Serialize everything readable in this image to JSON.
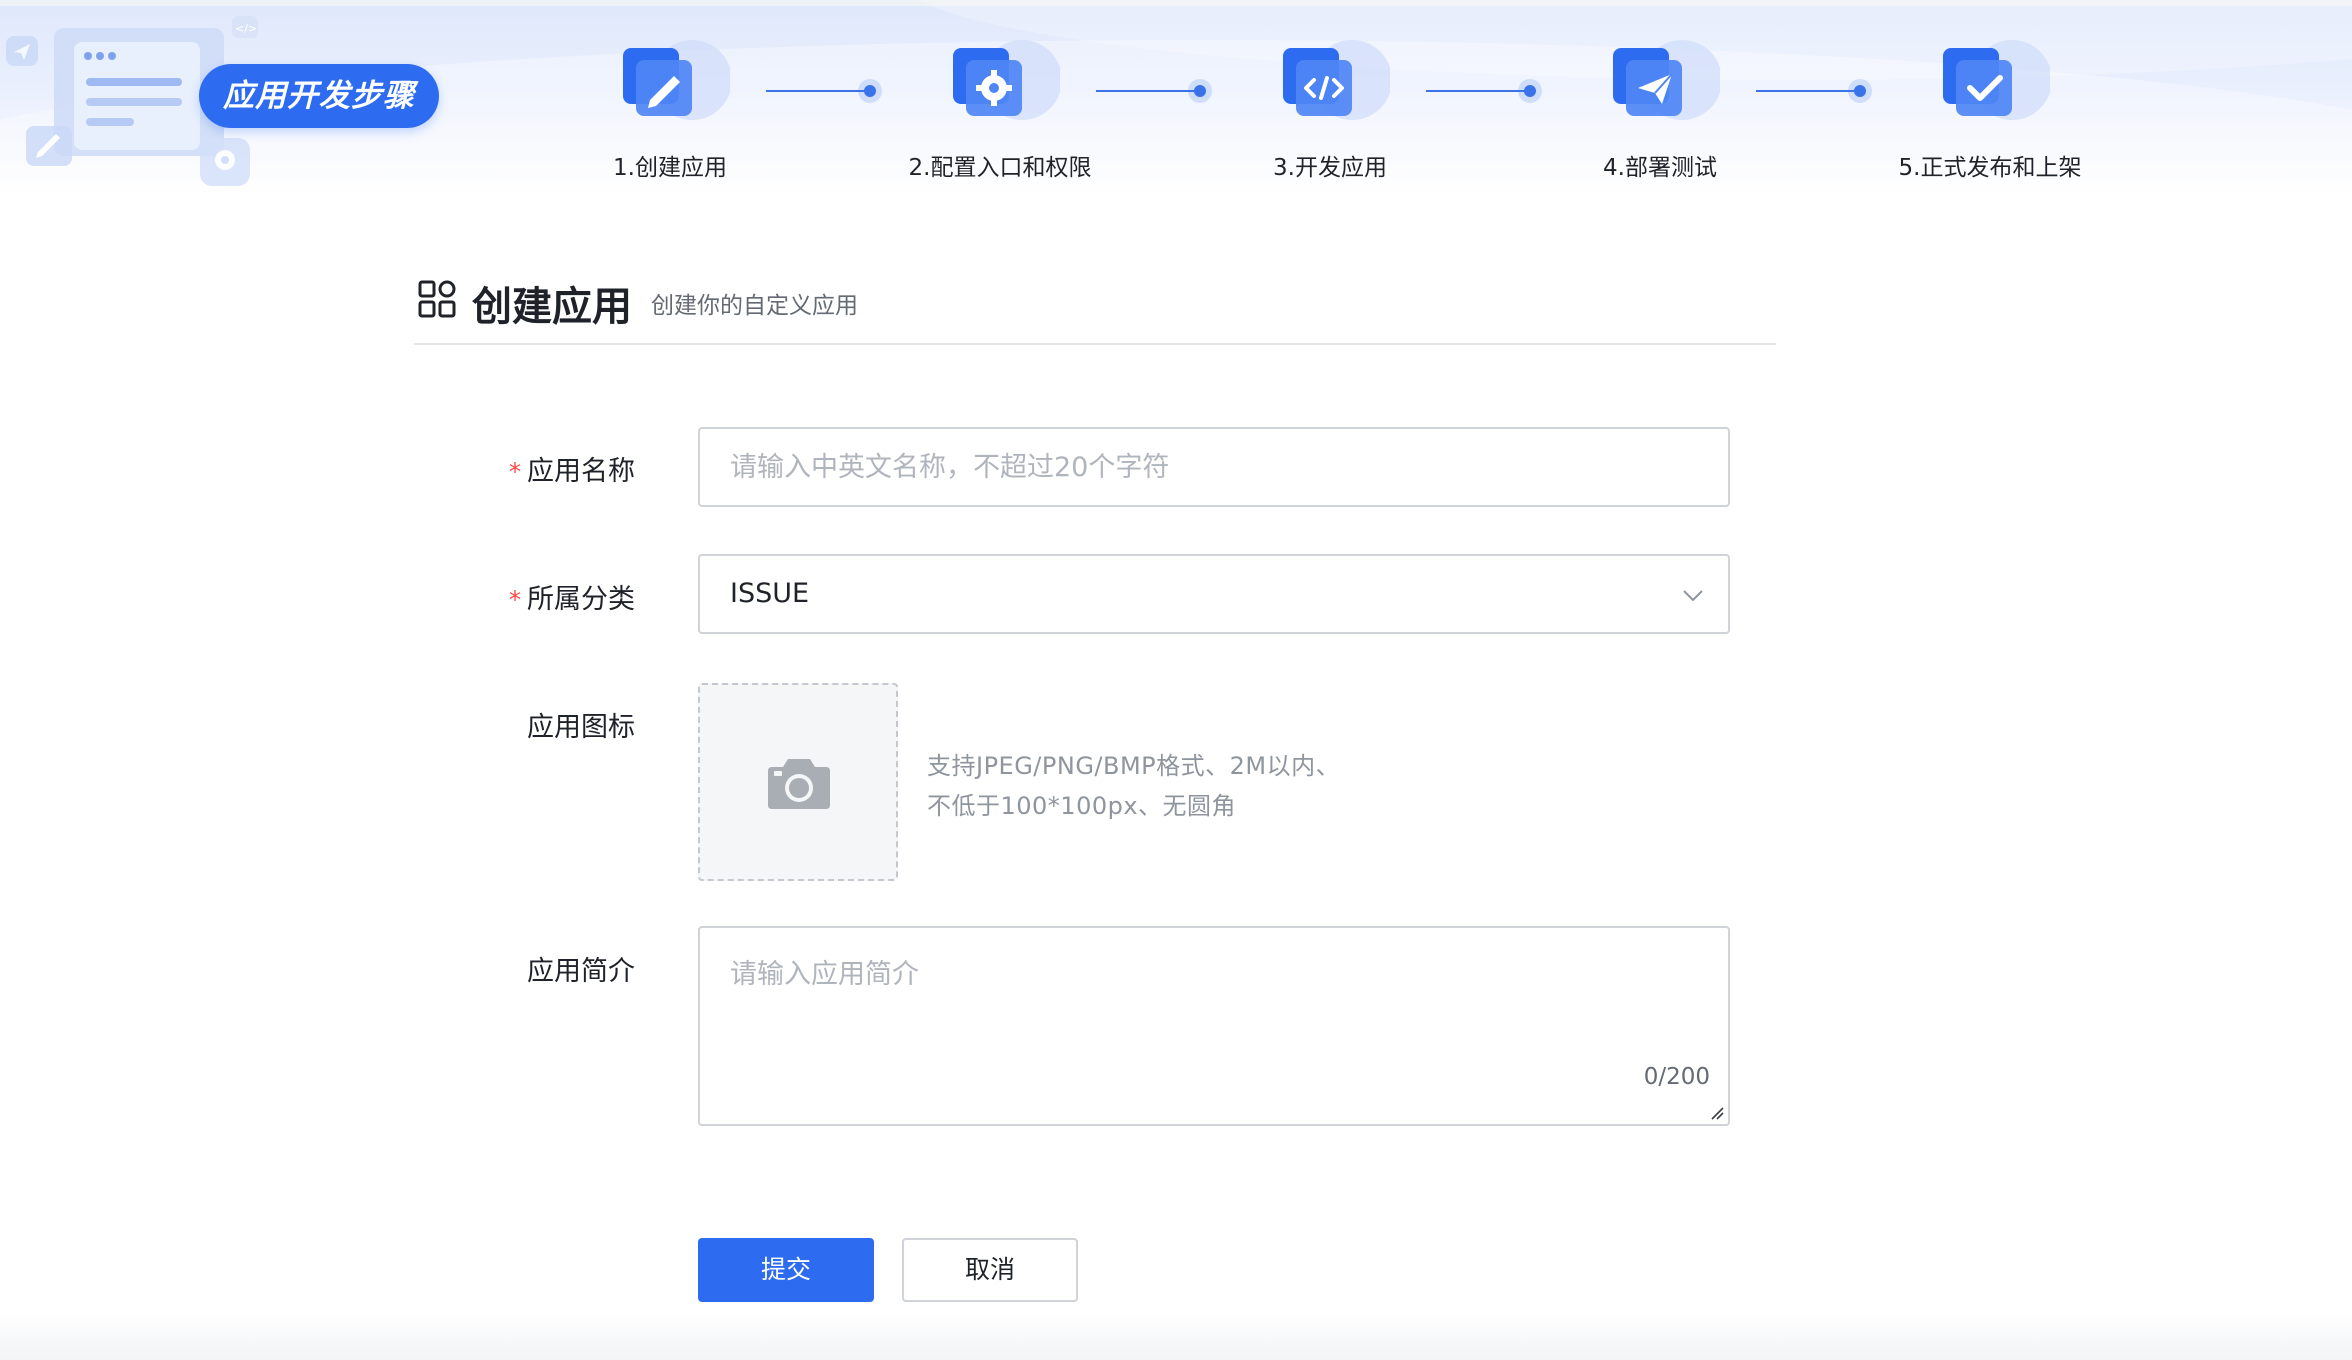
{
  "header": {
    "badge": "应用开发步骤",
    "steps": [
      {
        "label": "1.创建应用",
        "icon": "edit-pen-icon"
      },
      {
        "label": "2.配置入口和权限",
        "icon": "settings-gear-icon"
      },
      {
        "label": "3.开发应用",
        "icon": "code-icon"
      },
      {
        "label": "4.部署测试",
        "icon": "paper-plane-icon"
      },
      {
        "label": "5.正式发布和上架",
        "icon": "checkmark-icon"
      }
    ]
  },
  "section": {
    "title": "创建应用",
    "subtitle": "创建你的自定义应用"
  },
  "form": {
    "name": {
      "label": "应用名称",
      "placeholder": "请输入中英文名称，不超过20个字符",
      "value": "",
      "required": true
    },
    "category": {
      "label": "所属分类",
      "value": "ISSUE",
      "required": true
    },
    "icon": {
      "label": "应用图标",
      "hint_line1": "支持JPEG/PNG/BMP格式、2M以内、",
      "hint_line2": "不低于100*100px、无圆角"
    },
    "intro": {
      "label": "应用简介",
      "placeholder": "请输入应用简介",
      "counter": "0/200"
    }
  },
  "actions": {
    "submit": "提交",
    "cancel": "取消"
  },
  "colors": {
    "primary": "#2d6cf0",
    "required": "#f54a45",
    "text": "#1f2329",
    "muted": "#8f959e"
  }
}
